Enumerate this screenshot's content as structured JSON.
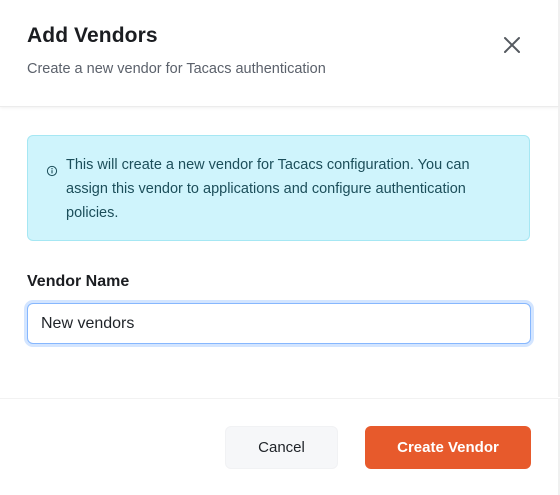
{
  "dialog": {
    "title": "Add Vendors",
    "subtitle": "Create a new vendor for Tacacs authentication",
    "close_icon": "close-icon"
  },
  "info": {
    "icon": "info-icon",
    "text": "This will create a new vendor for Tacacs configuration. You can assign this vendor to applications and configure authentication policies."
  },
  "form": {
    "vendor_name_label": "Vendor Name",
    "vendor_name_value": "New vendors"
  },
  "footer": {
    "cancel_label": "Cancel",
    "create_label": "Create Vendor"
  },
  "colors": {
    "primary": "#e75a2c",
    "info_bg": "#cff4fc",
    "focus_border": "#86b7fe"
  }
}
